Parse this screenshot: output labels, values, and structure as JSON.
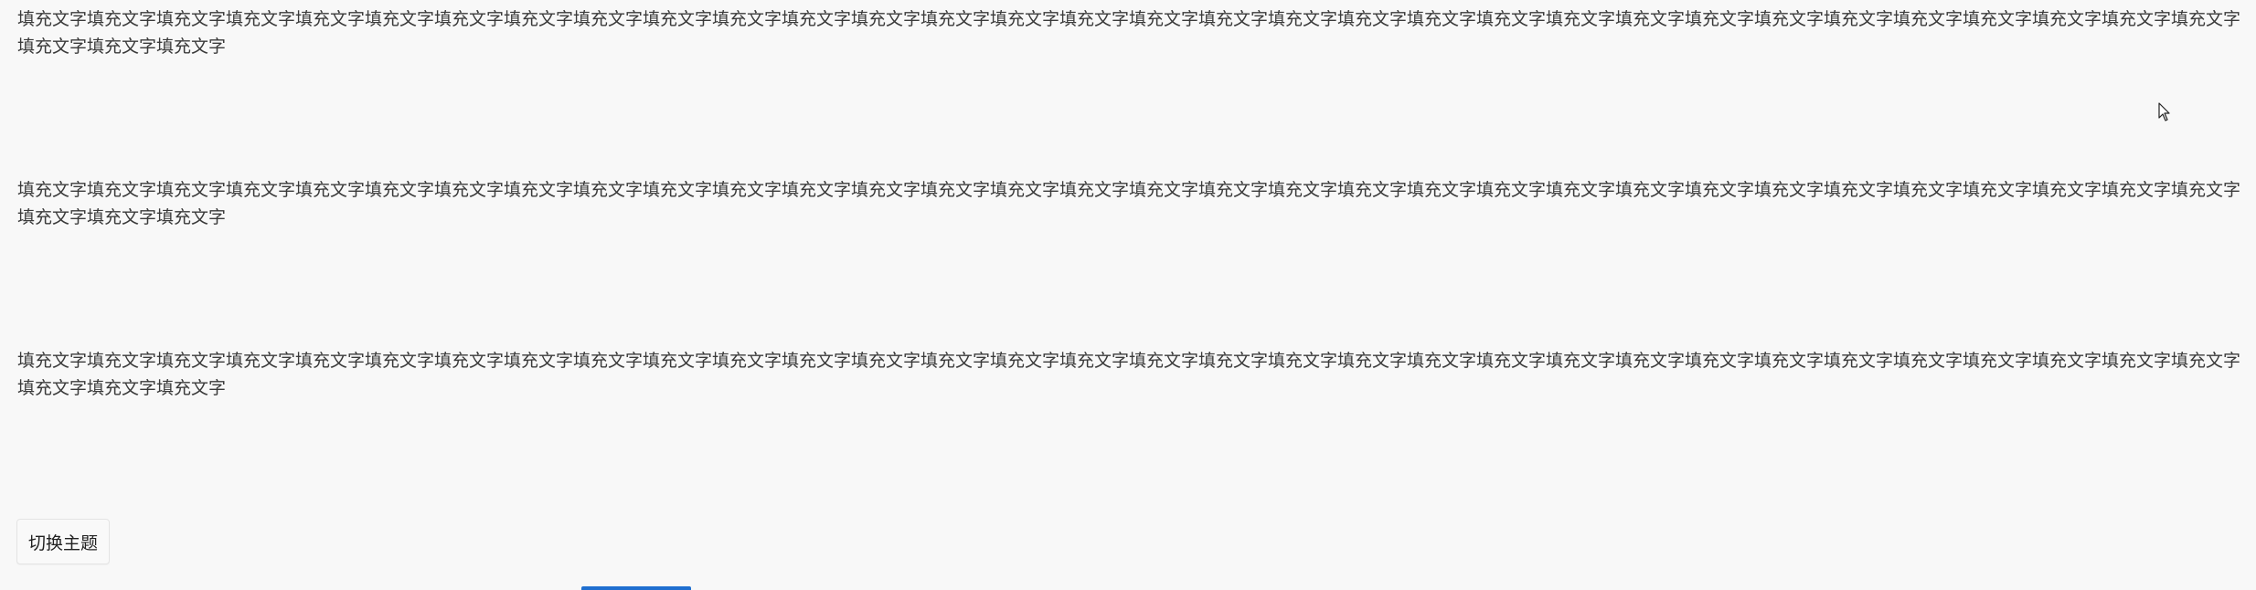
{
  "paragraphs": [
    "填充文字填充文字填充文字填充文字填充文字填充文字填充文字填充文字填充文字填充文字填充文字填充文字填充文字填充文字填充文字填充文字填充文字填充文字填充文字填充文字填充文字填充文字填充文字填充文字填充文字填充文字填充文字填充文字填充文字填充文字填充文字填充文字填充文字填充文字填充文字",
    "填充文字填充文字填充文字填充文字填充文字填充文字填充文字填充文字填充文字填充文字填充文字填充文字填充文字填充文字填充文字填充文字填充文字填充文字填充文字填充文字填充文字填充文字填充文字填充文字填充文字填充文字填充文字填充文字填充文字填充文字填充文字填充文字填充文字填充文字填充文字",
    "填充文字填充文字填充文字填充文字填充文字填充文字填充文字填充文字填充文字填充文字填充文字填充文字填充文字填充文字填充文字填充文字填充文字填充文字填充文字填充文字填充文字填充文字填充文字填充文字填充文字填充文字填充文字填充文字填充文字填充文字填充文字填充文字填充文字填充文字填充文字"
  ],
  "toggle_theme_button": {
    "label": "切换主题"
  },
  "colors": {
    "background": "#f8f8f8",
    "text": "#3a3a3a",
    "accent": "#1f6fd0"
  },
  "icons": {
    "cursor": "mouse-pointer-icon"
  }
}
